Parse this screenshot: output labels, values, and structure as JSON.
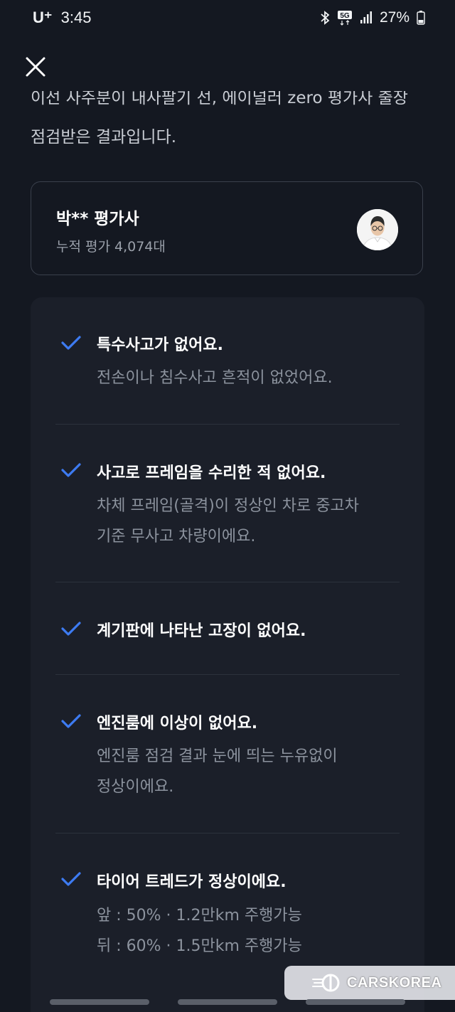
{
  "status_bar": {
    "carrier": "U⁺",
    "time": "3:45",
    "network": "5G",
    "battery": "27%"
  },
  "intro": {
    "line1_partial": "이선 사주분이 내사팔기 선, 에이널러 zero 평가사 출장",
    "line2": "점검받은 결과입니다."
  },
  "inspector": {
    "name": "박** 평가사",
    "count": "누적 평가 4,074대"
  },
  "checks": [
    {
      "title": "특수사고가 없어요.",
      "desc": [
        "전손이나 침수사고 흔적이 없었어요."
      ]
    },
    {
      "title": "사고로 프레임을 수리한 적 없어요.",
      "desc": [
        "차체 프레임(골격)이 정상인 차로 중고차",
        "기준 무사고 차량이에요."
      ]
    },
    {
      "title": "계기판에 나타난 고장이 없어요.",
      "desc": []
    },
    {
      "title": "엔진룸에 이상이 없어요.",
      "desc": [
        "엔진룸 점검 결과 눈에 띄는 누유없이",
        "정상이에요."
      ]
    },
    {
      "title": "타이어 트레드가 정상이에요.",
      "desc": [
        "앞 : 50% · 1.2만km 주행가능",
        "뒤 : 60% · 1.5만km 주행가능"
      ]
    }
  ],
  "watermark": {
    "text": "CARSKOREA"
  },
  "colors": {
    "background": "#141821",
    "panel": "#1b1f29",
    "check_accent": "#3d7bf2",
    "muted_text": "#8c939e"
  },
  "icons": {
    "close": "close-icon",
    "check": "check-icon",
    "bluetooth": "bluetooth-icon",
    "signal": "signal-icon",
    "battery": "battery-icon",
    "avatar": "avatar"
  }
}
